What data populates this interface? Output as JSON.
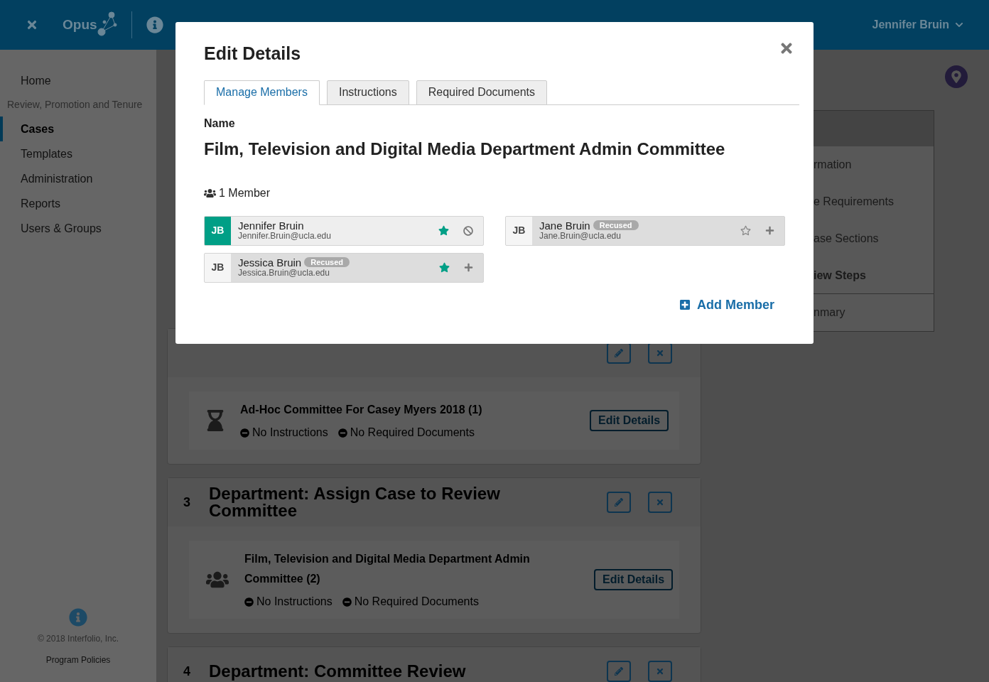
{
  "header": {
    "brand": "Opus",
    "user": "Jennifer Bruin"
  },
  "sidebar": {
    "items": [
      {
        "label": "Home",
        "kind": "link",
        "selected": false
      },
      {
        "label": "Review, Promotion and Tenure",
        "kind": "section"
      },
      {
        "label": "Cases",
        "kind": "link",
        "selected": true
      },
      {
        "label": "Templates",
        "kind": "link",
        "selected": false
      },
      {
        "label": "Administration",
        "kind": "link",
        "selected": false
      },
      {
        "label": "Reports",
        "kind": "link",
        "selected": false
      },
      {
        "label": "Users & Groups",
        "kind": "link",
        "selected": false
      }
    ],
    "copyright": "© 2018 Interfolio, Inc.",
    "policies": "Program Policies"
  },
  "steps": [
    {
      "tasks": [
        {
          "kind": "hourglass",
          "title": "Ad-Hoc Committee For Casey Myers 2018 (1)",
          "instructions": "No Instructions",
          "documents": "No Required Documents",
          "button": "Edit Details"
        }
      ]
    },
    {
      "number": "3",
      "title": "Department: Assign Case to Review Committee",
      "tasks": [
        {
          "kind": "group",
          "title": "Film, Television and Digital Media Department Admin Committee (2)",
          "instructions": "No Instructions",
          "documents": "No Required Documents",
          "button": "Edit Details"
        }
      ]
    },
    {
      "number": "4",
      "title": "Department: Committee Review"
    }
  ],
  "right_panel": {
    "items": [
      {
        "label": "rmation",
        "selected": false
      },
      {
        "label": "e Requirements",
        "selected": false
      },
      {
        "label": "ase Sections",
        "selected": false
      },
      {
        "label": "iew Steps",
        "selected": true
      },
      {
        "label": "nmary",
        "selected": false
      }
    ]
  },
  "modal": {
    "title": "Edit Details",
    "tabs": [
      {
        "label": "Manage Members",
        "selected": true
      },
      {
        "label": "Instructions",
        "selected": false
      },
      {
        "label": "Required Documents",
        "selected": false
      }
    ],
    "name_label": "Name",
    "name": "Film, Television and Digital Media Department Admin Committee",
    "member_count": "1 Member",
    "members": [
      {
        "initials": "JB",
        "name": "Jennifer Bruin",
        "email": "Jennifer.Bruin@ucla.edu",
        "member": true,
        "starred": true
      },
      {
        "initials": "JB",
        "name": "Jane Bruin",
        "email": "Jane.Bruin@ucla.edu",
        "member": false,
        "recused": "Recused",
        "starred": false
      },
      {
        "initials": "JB",
        "name": "Jessica Bruin",
        "email": "Jessica.Bruin@ucla.edu",
        "member": false,
        "recused": "Recused",
        "starred": true
      }
    ],
    "add_member": "Add Member"
  }
}
